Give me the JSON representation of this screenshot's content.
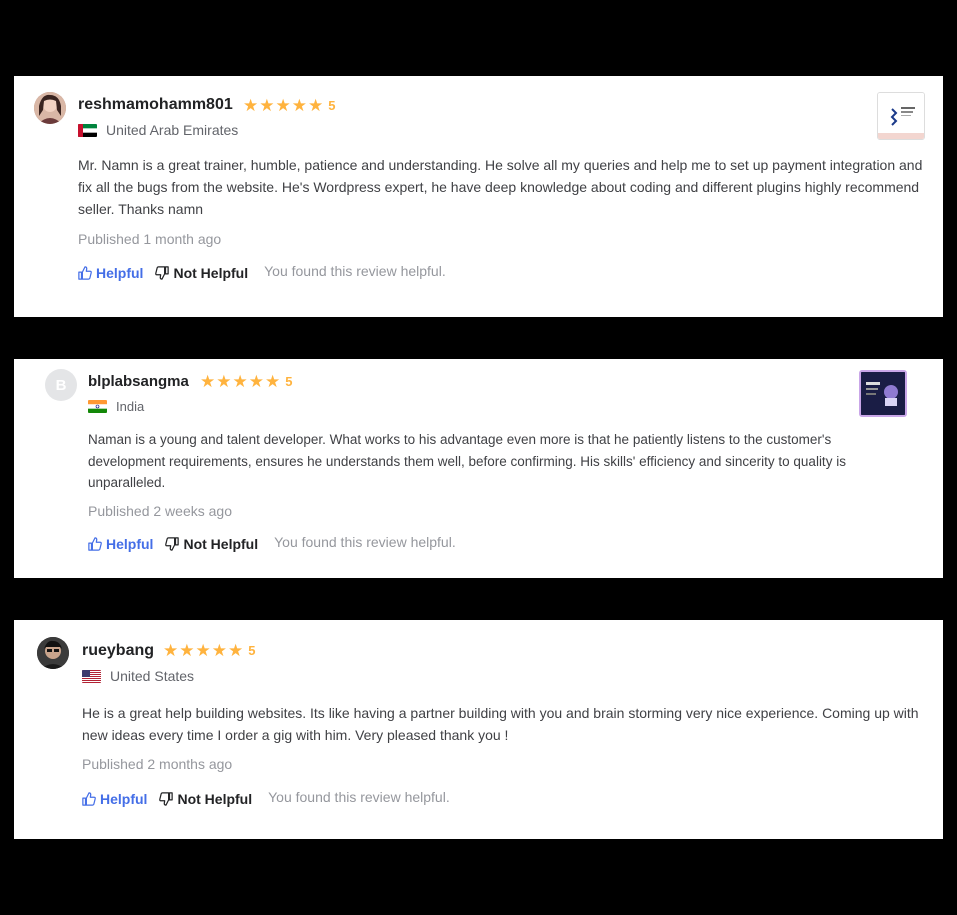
{
  "reviews": [
    {
      "username": "reshmamohamm801",
      "rating": "5",
      "country": "United Arab Emirates",
      "text": "Mr. Namn is a great trainer, humble, patience and understanding. He solve all my queries and help me to set up payment integration and fix all the bugs from the website. He's Wordpress expert, he have deep knowledge about coding and different plugins highly recommend seller. Thanks namn",
      "published": "Published 1 month ago",
      "helpful_label": "Helpful",
      "not_helpful_label": "Not Helpful",
      "feedback": "You found this review helpful."
    },
    {
      "username": "blplabsangma",
      "avatar_letter": "B",
      "rating": "5",
      "country": "India",
      "text": "Naman is a young and talent developer. What works to his advantage even more is that he patiently listens to the customer's development requirements, ensures he understands them well, before confirming. His skills' efficiency and sincerity to quality is unparalleled.",
      "published": "Published 2 weeks ago",
      "helpful_label": "Helpful",
      "not_helpful_label": "Not Helpful",
      "feedback": "You found this review helpful."
    },
    {
      "username": "rueybang",
      "rating": "5",
      "country": "United States",
      "text": "He is a great help building websites. Its like having a partner building with you and brain storming very nice experience. Coming up with new ideas every time I order a gig with him. Very pleased thank you !",
      "published": "Published 2 months ago",
      "helpful_label": "Helpful",
      "not_helpful_label": "Not Helpful",
      "feedback": "You found this review helpful."
    }
  ],
  "colors": {
    "star": "#ffb33e",
    "helpful": "#446ee7",
    "muted": "#95979d"
  }
}
